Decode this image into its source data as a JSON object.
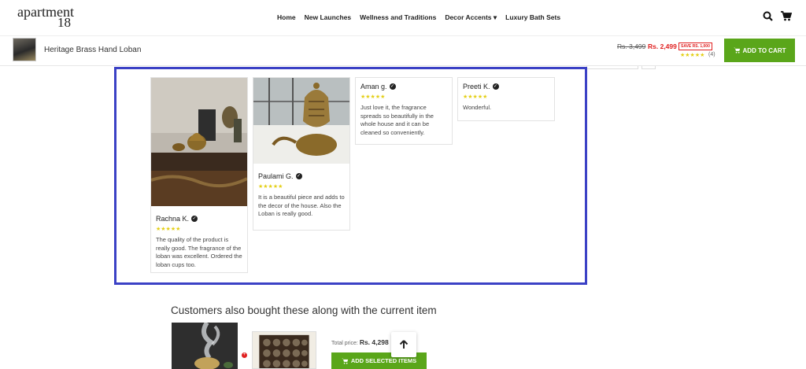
{
  "brand": {
    "logo_line1": "apartment",
    "logo_line2": "18"
  },
  "nav": [
    "Home",
    "New Launches",
    "Wellness and Traditions",
    "Decor Accents ▾",
    "Luxury Bath Sets"
  ],
  "sticky": {
    "product_title": "Heritage Brass Hand Loban",
    "price_old": "Rs. 3,499",
    "price_new": "Rs. 2,499",
    "save_badge": "SAVE RS. 1,000",
    "stars": "★★★★★",
    "review_count": "(4)",
    "add_to_cart": "ADD TO CART"
  },
  "reviews": [
    {
      "name": "Rachna K.",
      "stars": "★★★★★",
      "text": "The quality of the product is really good. The fragrance of the loban was excellent. Ordered the loban cups too."
    },
    {
      "name": "Paulami G.",
      "stars": "★★★★★",
      "text": "It is a beautiful piece and adds to the decor of the house. Also the Loban is really good."
    },
    {
      "name": "Aman g.",
      "stars": "★★★★★",
      "text": "Just love it, the fragrance spreads so beautifully in the whole house and it can be cleaned so conveniently."
    },
    {
      "name": "Preeti K.",
      "stars": "★★★★★",
      "text": "Wonderful."
    }
  ],
  "also_bought": {
    "title": "Customers also bought these along with the current item",
    "total_label": "Total price:",
    "total_value": "Rs. 4,298",
    "add_selected": "ADD SELECTED ITEMS"
  },
  "colors": {
    "accent_green": "#5aa61a",
    "highlight_border": "#3b41c5",
    "price_red": "#e02020",
    "star_yellow": "#e4cf16"
  }
}
